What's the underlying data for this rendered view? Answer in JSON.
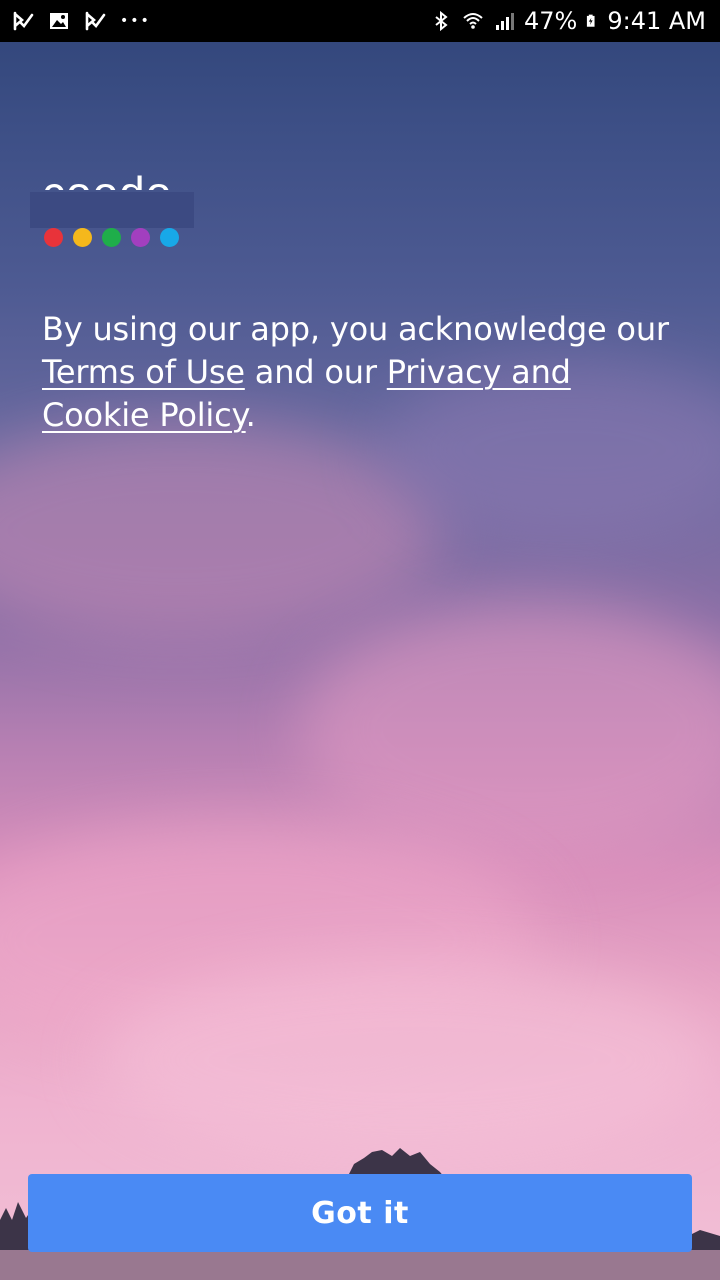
{
  "status_bar": {
    "left_icons": [
      "checkmark-flag-icon",
      "image-icon",
      "checkmark-flag-icon",
      "more-dots-icon"
    ],
    "more_label": "•••",
    "right_icons": [
      "bluetooth-icon",
      "wifi-icon",
      "signal-icon",
      "battery-icon"
    ],
    "battery": "47%",
    "time": "9:41 AM"
  },
  "logo": {
    "text": "coodo",
    "dot_colors": [
      "#e8333a",
      "#f5b81c",
      "#1fae4a",
      "#a23fbf",
      "#18a8e8"
    ]
  },
  "consent": {
    "prefix": "By using our app, you acknowledge our ",
    "terms_link": "Terms of Use",
    "middle": " and our ",
    "privacy_link": "Privacy and Cookie Policy",
    "suffix": "."
  },
  "button": {
    "label": "Got it"
  },
  "colors": {
    "button_blue": "#4a8af4",
    "status_bar_bg": "#000000",
    "sky_top": "#2f4478",
    "sky_bottom": "#f2c0d6"
  }
}
